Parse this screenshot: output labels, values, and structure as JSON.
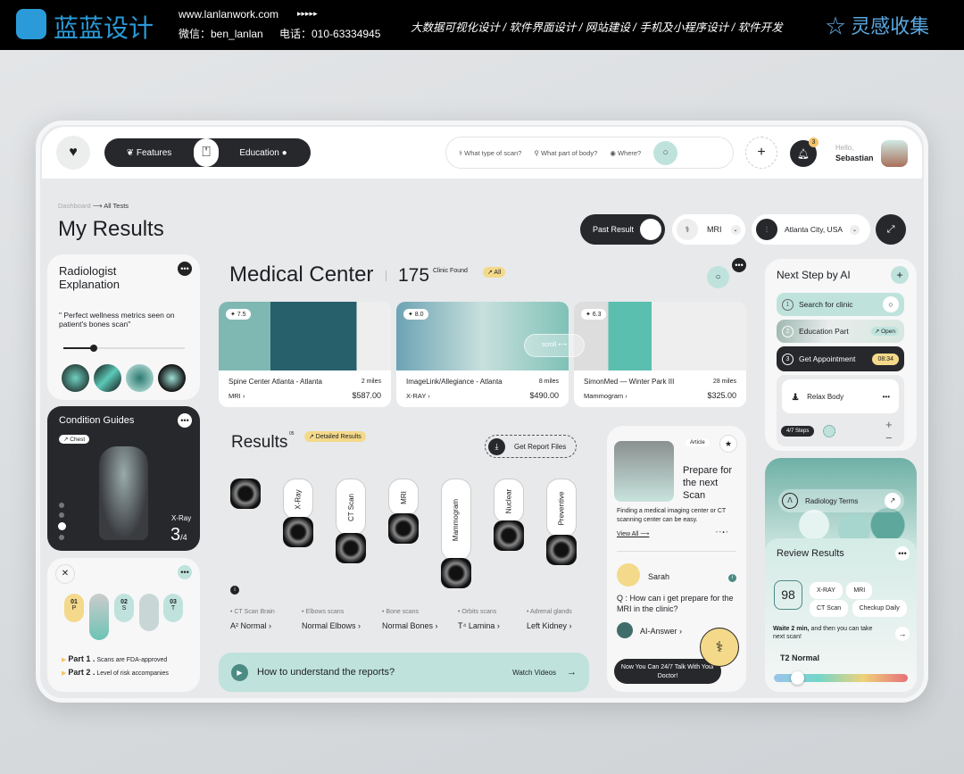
{
  "banner": {
    "brand": "蓝蓝设计",
    "url": "www.lanlanwork.com",
    "arrows": "▸▸▸▸▸",
    "wechat": "微信：ben_lanlan",
    "phone": "电话：010-63334945",
    "services": "大数据可视化设计 / 软件界面设计 / 网站建设 / 手机及小程序设计 / 软件开发",
    "collect": "灵感收集"
  },
  "nav": {
    "features": "Features",
    "education": "Education"
  },
  "search": {
    "scan": "What type of scan?",
    "body": "What part of body?",
    "where": "Where?"
  },
  "user": {
    "greeting": "Hello,",
    "name": "Sebastian",
    "notifications": "3"
  },
  "breadcrumb": {
    "root": "Dashboard",
    "current": "All Tests"
  },
  "page_title": "My Results",
  "filters": {
    "past": "Past Result",
    "scan": "MRI",
    "location": "Atlanta City, USA"
  },
  "radiologist": {
    "title": "Radiologist Explanation",
    "quote": "\" Perfect wellness metrics seen on patient's bones scan\"",
    "progress": 0.25
  },
  "guides": {
    "title": "Condition Guides",
    "tag": "↗ Chest",
    "type": "X-Ray",
    "page": "3",
    "total": "/4"
  },
  "parts": {
    "steps": [
      {
        "n": "01",
        "l": "P"
      },
      {
        "n": "02",
        "l": "S"
      },
      {
        "n": "03",
        "l": "T"
      }
    ],
    "p1": "Part 1 .",
    "p1t": "Scans are FDA-approved",
    "p2": "Part 2 .",
    "p2t": "Level of risk accompanies"
  },
  "medical": {
    "title": "Medical Center",
    "count": "175",
    "found": "Clinic Found",
    "all": "↗ All",
    "scroll": "scroll ⟷",
    "clinics": [
      {
        "rating": "✦ 7.5",
        "name": "Spine Center Atlanta - Atlanta",
        "dist": "2 miles",
        "type": "MRI ›",
        "price": "$587.00"
      },
      {
        "rating": "✦ 8.0",
        "name": "ImageLink/Allegiance - Atlanta",
        "dist": "8 miles",
        "type": "X-RAY ›",
        "price": "$490.00"
      },
      {
        "rating": "✦ 6.3",
        "name": "SimonMed — Winter Park III",
        "dist": "28 miles",
        "type": "Mammogram ›",
        "price": "$325.00"
      }
    ]
  },
  "results": {
    "title": "Results",
    "sup": "05",
    "detail": "↗ Detailed Results",
    "report": "Get Report Files",
    "tabs": [
      "X-Ray",
      "CT Scan",
      "MRI",
      "Mammogram",
      "Nuclear",
      "Preventive"
    ],
    "items": [
      {
        "k": "CT Scan Brain",
        "v": "A² Normal ›"
      },
      {
        "k": "Elbows scans",
        "v": "Normal Elbows ›"
      },
      {
        "k": "Bone scans",
        "v": "Normal Bones ›"
      },
      {
        "k": "Orbits scans",
        "v": "T⁴ Lamina ›"
      },
      {
        "k": "Adrenal glands",
        "v": "Left Kidney ›"
      }
    ],
    "video": "How to understand the reports?",
    "watch": "Watch Videos"
  },
  "article": {
    "tag": "Article",
    "title": "Prepare for the next Scan",
    "desc": "Finding a medical imaging center or CT scanning center can be easy.",
    "view": "View All",
    "user": "Sarah",
    "q": "Q : How can i get prepare for the MRI in the clinic?",
    "ai": "AI-Answer ›",
    "cta": "Now You Can 24/7 Talk With Your Doctor!"
  },
  "nextstep": {
    "title": "Next Step by AI",
    "s1": "Search for clinic",
    "s2": "Education Part",
    "open": "↗ Open",
    "s3": "Get Appointment",
    "time": "08:34",
    "relax": "Relax Body",
    "steps": "4/7 Steps"
  },
  "review": {
    "terms": "Radiology Terms",
    "title": "Review Results",
    "score": "98",
    "chips": [
      "X-RAY",
      "MRI",
      "CT Scan",
      "Checkup Daily"
    ],
    "wait_b": "Waite 2 min,",
    "wait": " and then you can take next scan!",
    "status": "T2 Normal",
    "level": 0.17
  },
  "colors": {
    "accent": "#bfe3dc",
    "dark": "#26282c",
    "yellow": "#f4d98a"
  }
}
